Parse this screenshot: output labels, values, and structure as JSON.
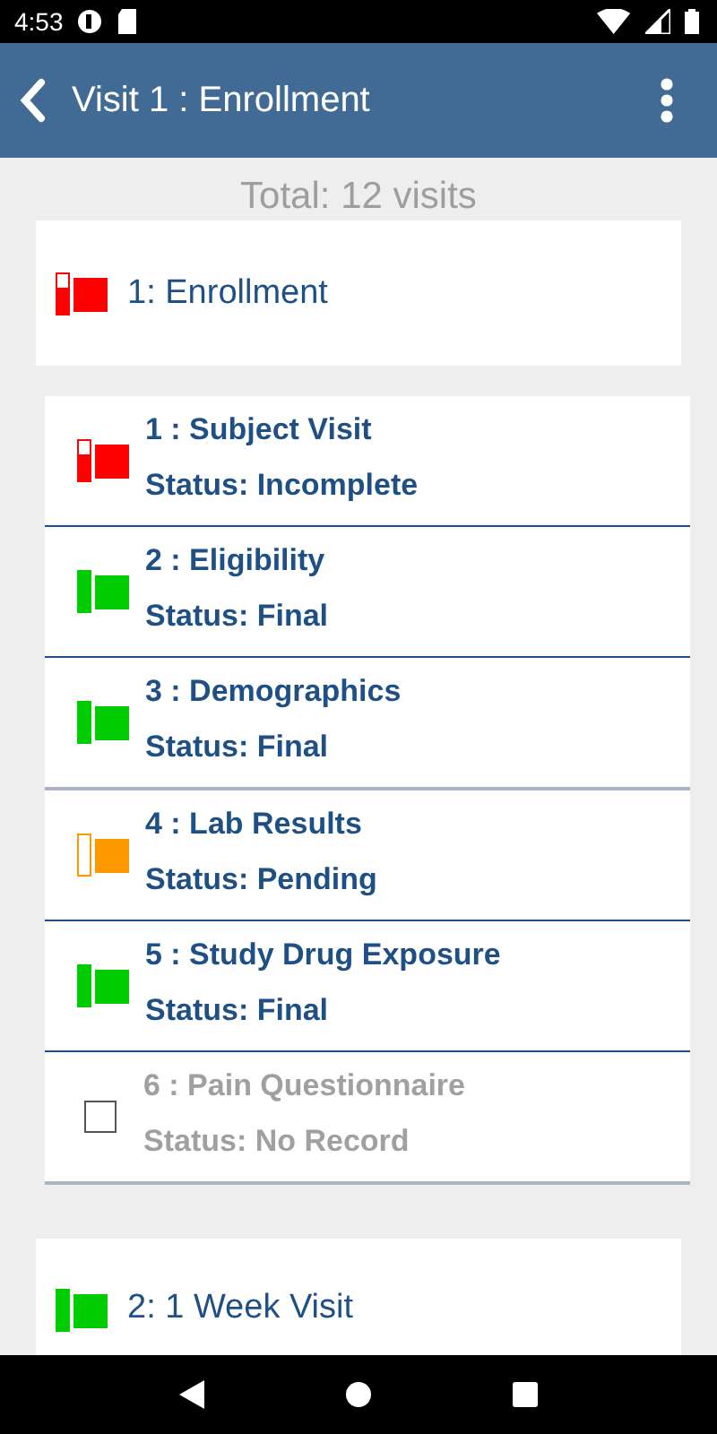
{
  "status_bar": {
    "time": "4:53"
  },
  "app_bar": {
    "title": "Visit 1 : Enrollment"
  },
  "total": "Total: 12 visits",
  "visits": [
    {
      "label": "1: Enrollment",
      "kind": "incomplete",
      "forms": [
        {
          "title": "1 : Subject Visit",
          "status": "Status: Incomplete",
          "kind": "incomplete"
        },
        {
          "title": "2 : Eligibility",
          "status": "Status: Final",
          "kind": "final"
        },
        {
          "title": "3 : Demographics",
          "status": "Status: Final",
          "kind": "final"
        },
        {
          "title": "4 : Lab Results",
          "status": "Status: Pending",
          "kind": "pending"
        },
        {
          "title": "5 : Study Drug Exposure",
          "status": "Status: Final",
          "kind": "final"
        },
        {
          "title": "6 : Pain Questionnaire",
          "status": "Status: No Record",
          "kind": "none"
        }
      ]
    },
    {
      "label": "2: 1 Week Visit",
      "kind": "final"
    }
  ]
}
